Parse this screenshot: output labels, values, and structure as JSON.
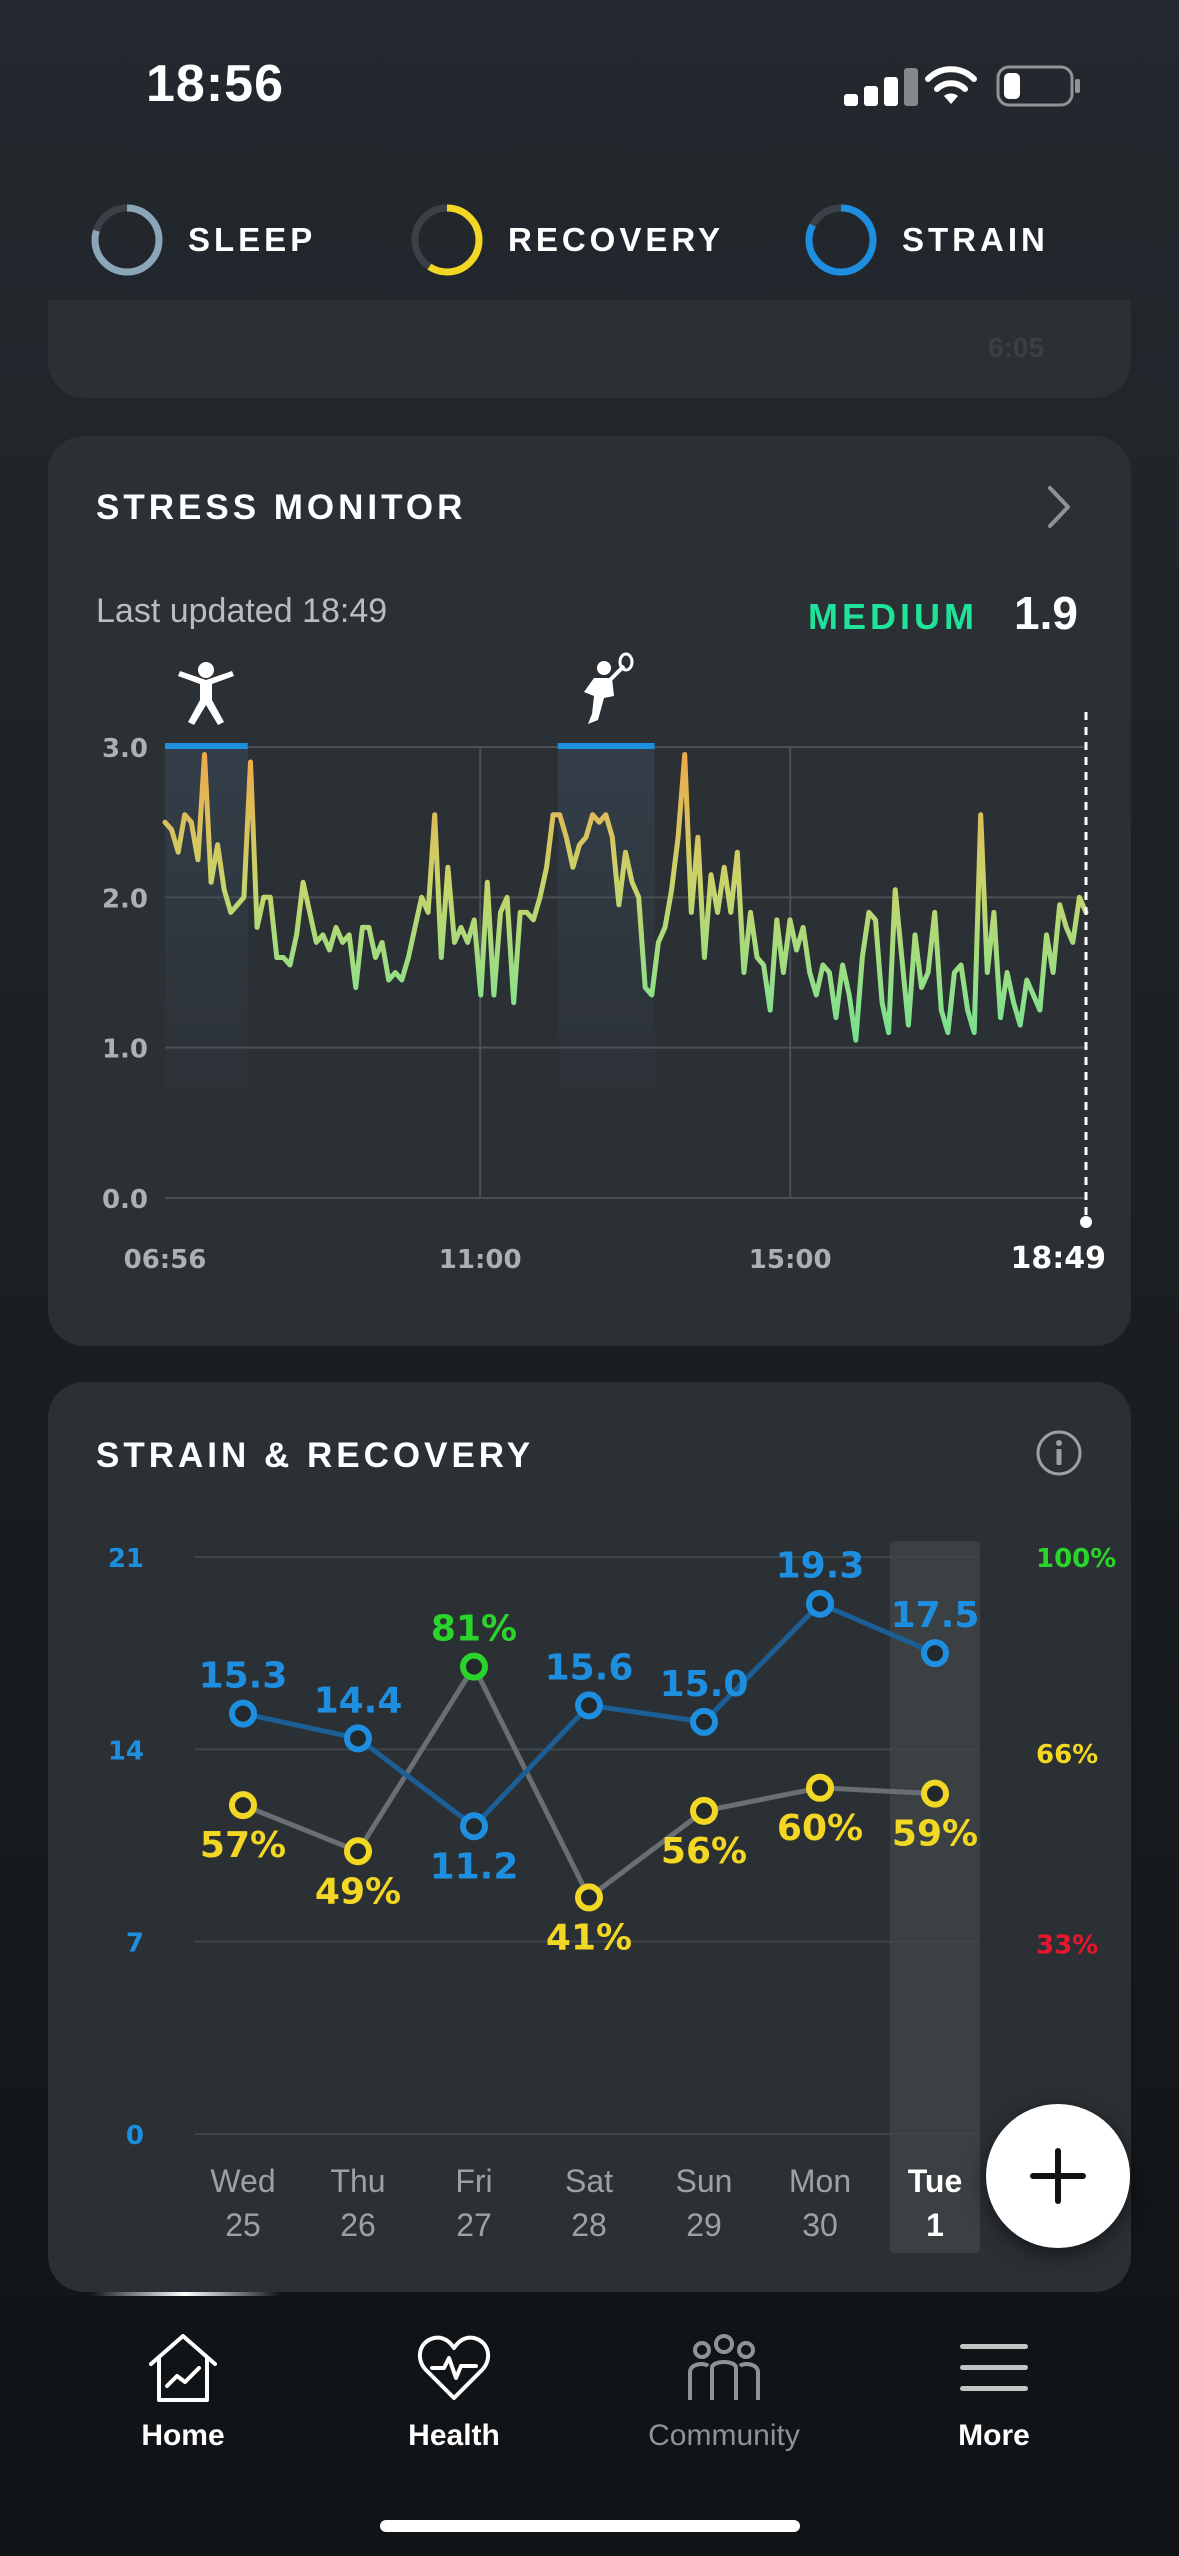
{
  "status_bar": {
    "time": "18:56"
  },
  "top_nav": {
    "sleep": {
      "label": "SLEEP",
      "color": "#8aa6b8"
    },
    "recovery": {
      "label": "RECOVERY",
      "color": "#f2d724"
    },
    "strain": {
      "label": "STRAIN",
      "color": "#1e8fe0"
    }
  },
  "prev_card": {
    "partial_time": "6:05"
  },
  "stress_monitor": {
    "title": "STRESS MONITOR",
    "last_updated": "Last updated 18:49",
    "level_label": "MEDIUM",
    "level_value": "1.9",
    "activity_icons": [
      "person-star-icon",
      "tennis-player-icon"
    ],
    "chart_data": {
      "type": "line",
      "x_tick_labels": [
        "06:56",
        "11:00",
        "15:00",
        "18:49"
      ],
      "y_tick_labels": [
        "3.0",
        "2.0",
        "1.0",
        "0.0"
      ],
      "ylim": [
        0,
        3
      ],
      "xlim": [
        "06:56",
        "18:49"
      ],
      "grid": true,
      "activity_bands": [
        {
          "start": "06:56",
          "end": "08:00"
        },
        {
          "start": "12:00",
          "end": "13:15"
        }
      ],
      "series": [
        {
          "values": [
            2.5,
            2.45,
            2.3,
            2.55,
            2.5,
            2.25,
            2.95,
            2.1,
            2.35,
            2.05,
            1.9,
            1.95,
            2.0,
            2.9,
            1.8,
            2.0,
            2.0,
            1.6,
            1.6,
            1.55,
            1.75,
            2.1,
            1.9,
            1.7,
            1.75,
            1.65,
            1.8,
            1.7,
            1.75,
            1.4,
            1.8,
            1.8,
            1.6,
            1.7,
            1.45,
            1.5,
            1.45,
            1.6,
            1.8,
            2.0,
            1.9,
            2.55,
            1.6,
            2.2,
            1.7,
            1.8,
            1.7,
            1.85,
            1.35,
            2.1,
            1.35,
            1.9,
            2.0,
            1.3,
            1.9,
            1.9,
            1.85,
            2.0,
            2.2,
            2.55,
            2.55,
            2.4,
            2.2,
            2.35,
            2.4,
            2.55,
            2.5,
            2.55,
            2.4,
            1.95,
            2.3,
            2.1,
            2.0,
            1.4,
            1.35,
            1.7,
            1.8,
            2.05,
            2.4,
            2.95,
            1.9,
            2.4,
            1.6,
            2.15,
            1.9,
            2.2,
            1.9,
            2.3,
            1.5,
            1.9,
            1.6,
            1.55,
            1.25,
            1.85,
            1.5,
            1.85,
            1.65,
            1.8,
            1.5,
            1.35,
            1.55,
            1.5,
            1.2,
            1.55,
            1.35,
            1.05,
            1.6,
            1.9,
            1.85,
            1.3,
            1.1,
            2.05,
            1.6,
            1.15,
            1.75,
            1.4,
            1.5,
            1.9,
            1.25,
            1.1,
            1.5,
            1.55,
            1.25,
            1.1,
            2.55,
            1.5,
            1.9,
            1.2,
            1.5,
            1.3,
            1.15,
            1.45,
            1.35,
            1.25,
            1.75,
            1.5,
            1.95,
            1.8,
            1.7,
            2.0,
            1.9
          ]
        }
      ]
    }
  },
  "strain_recovery": {
    "title": "STRAIN & RECOVERY",
    "info_icon": "info-icon",
    "chart_data": {
      "type": "line",
      "categories": [
        "Wed 25",
        "Thu 26",
        "Fri 27",
        "Sat 28",
        "Sun 29",
        "Mon 30",
        "Tue 1"
      ],
      "day_names": [
        "Wed",
        "Thu",
        "Fri",
        "Sat",
        "Sun",
        "Mon",
        "Tue"
      ],
      "day_numbers": [
        "25",
        "26",
        "27",
        "28",
        "29",
        "30",
        "1"
      ],
      "selected_index": 6,
      "left_axis": {
        "ticks": [
          "21",
          "14",
          "7",
          "0"
        ],
        "ylim": [
          0,
          21
        ],
        "color": "#1e8fe0"
      },
      "right_axis": {
        "ticks": [
          "100%",
          "66%",
          "33%"
        ],
        "colors": [
          "#2bd42b",
          "#f2d724",
          "#e8152d"
        ],
        "ylim": [
          0,
          100
        ]
      },
      "series": [
        {
          "values": [
            15.3,
            14.4,
            11.2,
            15.6,
            15.0,
            19.3,
            17.5
          ],
          "labels": [
            "15.3",
            "14.4",
            "11.2",
            "15.6",
            "15.0",
            "19.3",
            "17.5"
          ],
          "color": "#1e8fe0",
          "axis": "left"
        },
        {
          "values": [
            57,
            49,
            81,
            41,
            56,
            60,
            59
          ],
          "labels": [
            "57%",
            "49%",
            "81%",
            "41%",
            "56%",
            "60%",
            "59%"
          ],
          "colors": [
            "#f2d724",
            "#f2d724",
            "#2bd42b",
            "#f2d724",
            "#f2d724",
            "#f2d724",
            "#f2d724"
          ],
          "axis": "right"
        }
      ]
    }
  },
  "fab": {
    "icon": "plus-icon"
  },
  "bottom_nav": {
    "items": [
      {
        "label": "Home",
        "icon": "home-icon",
        "active": true
      },
      {
        "label": "Health",
        "icon": "heart-pulse-icon",
        "active": true
      },
      {
        "label": "Community",
        "icon": "community-icon",
        "active": false
      },
      {
        "label": "More",
        "icon": "menu-icon",
        "active": true
      }
    ]
  },
  "colors": {
    "accent_green": "#1fe39a",
    "strain_blue": "#1e8fe0",
    "recovery_yellow": "#f2d724",
    "card_bg": "#2b3034"
  }
}
